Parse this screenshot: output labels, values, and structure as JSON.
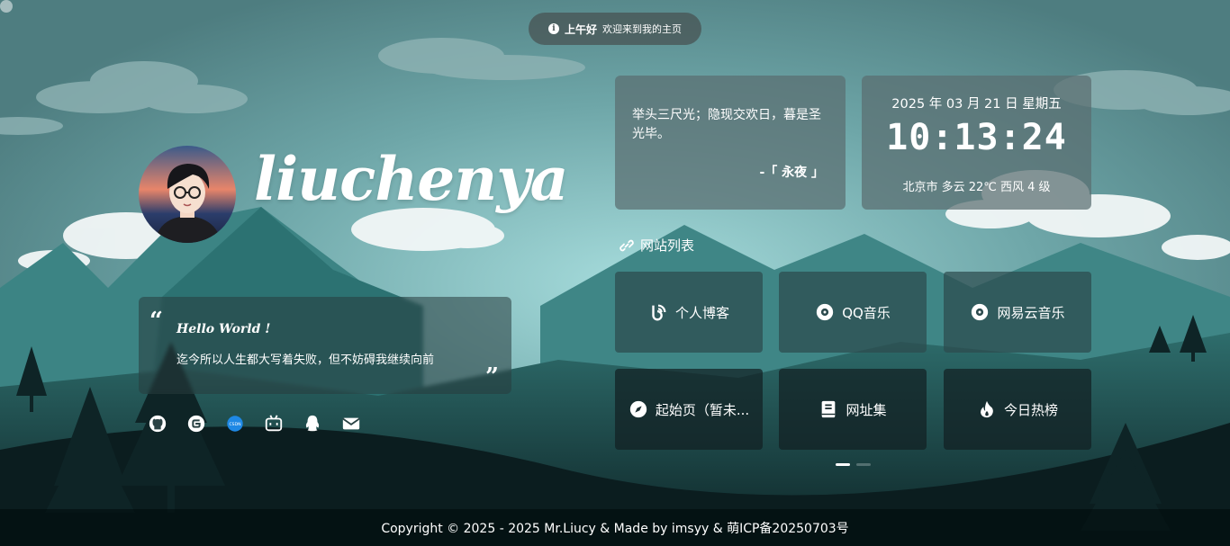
{
  "greeting": {
    "time_of_day": "上午好",
    "message": "欢迎来到我的主页"
  },
  "profile": {
    "site_name": "liuchenya"
  },
  "quote": {
    "title": "Hello World !",
    "text": "迄今所以人生都大写着失败，但不妨碍我继续向前"
  },
  "socials": [
    {
      "icon": "github-icon"
    },
    {
      "icon": "gitee-icon"
    },
    {
      "icon": "csdn-icon"
    },
    {
      "icon": "bilibili-icon"
    },
    {
      "icon": "qq-icon"
    },
    {
      "icon": "mail-icon"
    }
  ],
  "hitokoto": {
    "text": "举头三尺光；隐现交欢日，暮是圣光毕。",
    "from": "-「 永夜 」"
  },
  "time": {
    "date": "2025 年 03 月 21 日 星期五",
    "clock": "10:13:24",
    "weather": "北京市 多云 22℃  西风  4 级"
  },
  "sites": {
    "title": "网站列表",
    "items": [
      {
        "label": "个人博客",
        "icon": "blog-icon"
      },
      {
        "label": "QQ音乐",
        "icon": "music-disc-icon"
      },
      {
        "label": "网易云音乐",
        "icon": "music-disc-icon"
      },
      {
        "label": "起始页（暂未...",
        "icon": "compass-icon"
      },
      {
        "label": "网址集",
        "icon": "book-icon"
      },
      {
        "label": "今日热榜",
        "icon": "fire-icon"
      }
    ],
    "pages": 2,
    "current_page": 1
  },
  "footer": {
    "text": "Copyright © 2025 - 2025 Mr.Liucy & Made by imsyy & 萌ICP备20250703号"
  },
  "colors": {
    "accent": "#ffffff",
    "panel": "#5a6e70",
    "sky": "#8cc7c8"
  }
}
